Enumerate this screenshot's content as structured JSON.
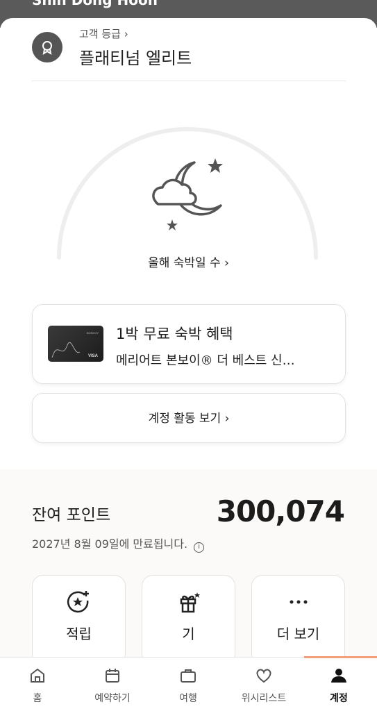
{
  "header": {
    "user_name": "Shin Dong Hoon"
  },
  "tier": {
    "label": "고객 등급 ›",
    "value": "플래티넘 엘리트"
  },
  "nights": {
    "link_label": "올해 숙박일 수 ›"
  },
  "benefit_card": {
    "title": "1박 무료 숙박 혜택",
    "description": "메리어트 본보이® 더 베스트 신…"
  },
  "activity": {
    "label": "계정 활동 보기 ›"
  },
  "points": {
    "label": "잔여 포인트",
    "value": "300,074",
    "expiry": "2027년 8월 09일에 만료됩니다.",
    "info_glyph": "i"
  },
  "tiles": [
    {
      "label": "적립",
      "icon": "star-plus-icon"
    },
    {
      "label": "기",
      "icon": "gift-icon"
    },
    {
      "label": "더 보기",
      "icon": "more-icon"
    }
  ],
  "nav": {
    "items": [
      {
        "label": "홈",
        "icon": "home-icon"
      },
      {
        "label": "예약하기",
        "icon": "calendar-icon"
      },
      {
        "label": "여행",
        "icon": "suitcase-icon"
      },
      {
        "label": "위시리스트",
        "icon": "heart-icon"
      },
      {
        "label": "계정",
        "icon": "user-icon"
      }
    ],
    "active": "계정"
  },
  "colors": {
    "accent": "#f0a07a",
    "text": "#1c1c1c",
    "muted": "#555555"
  }
}
